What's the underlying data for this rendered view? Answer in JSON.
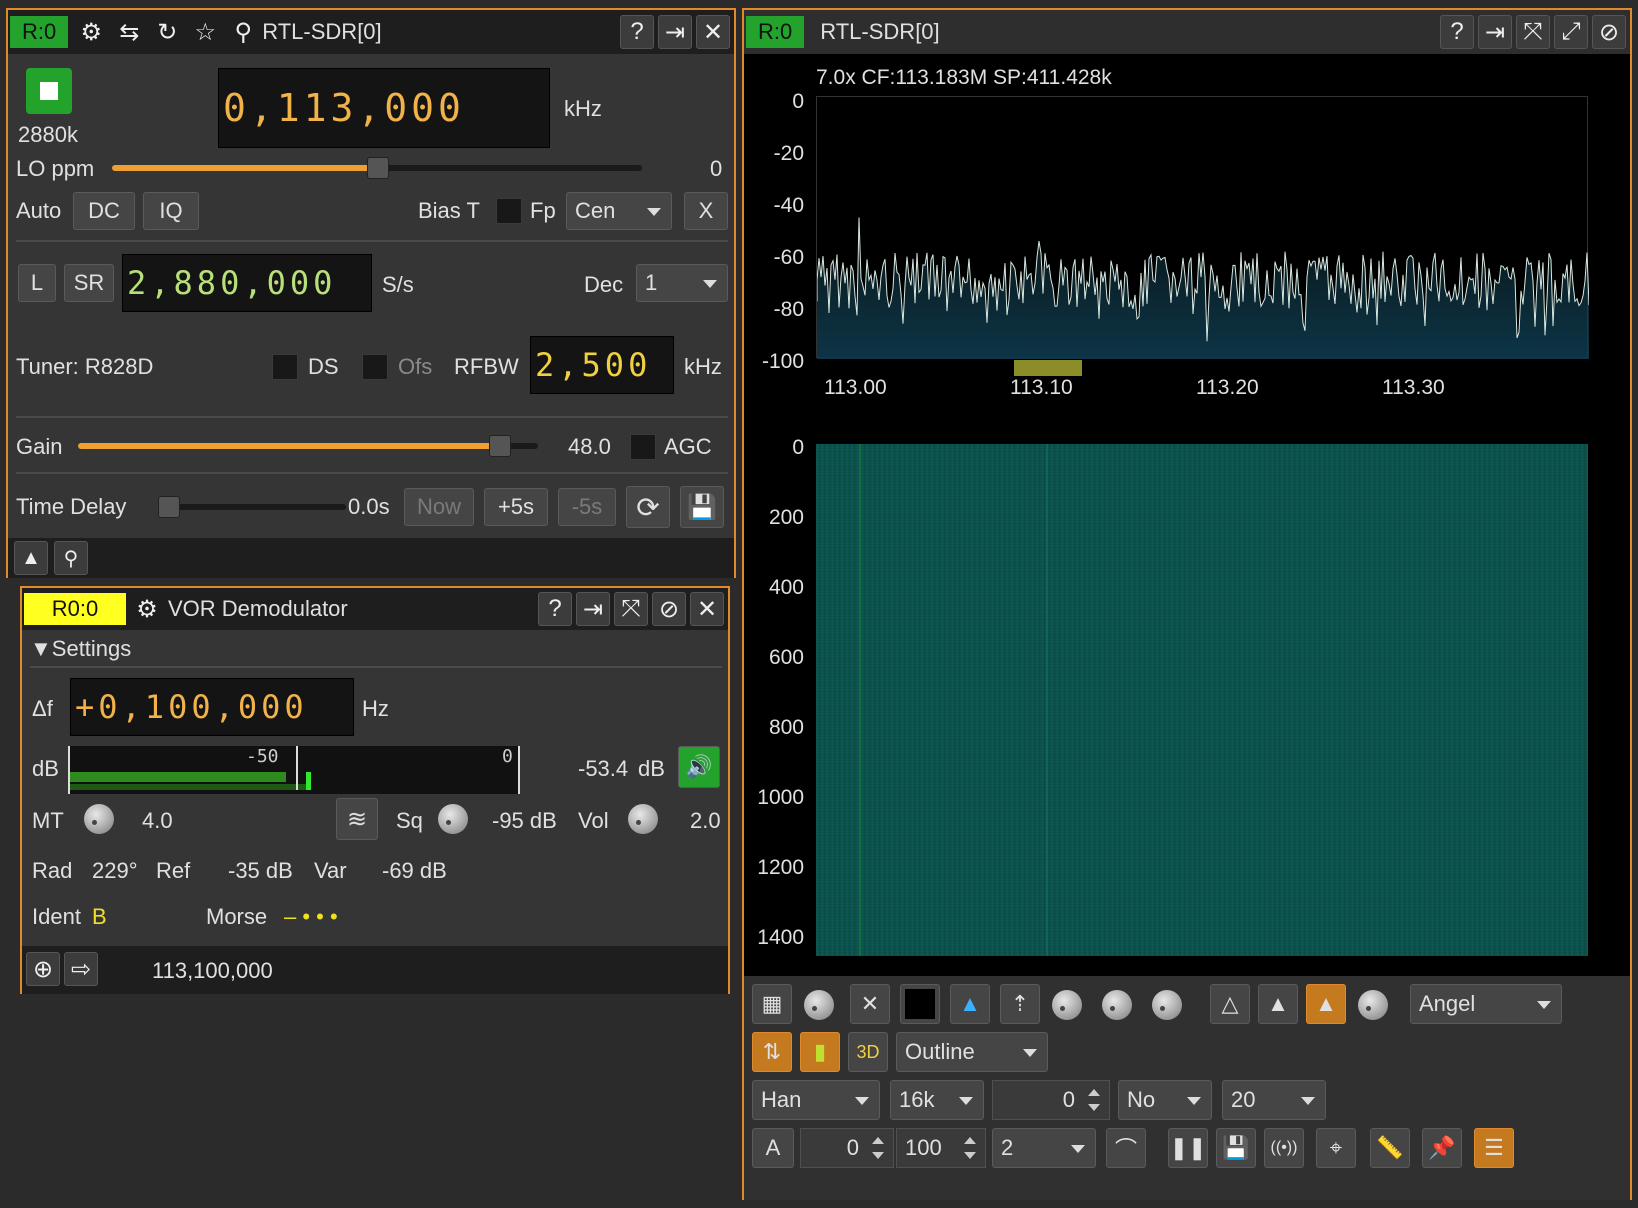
{
  "device": {
    "badge": "R:0",
    "title": "RTL-SDR[0]",
    "sample_rate_label": "2880k",
    "center_freq": "0,113,000",
    "center_freq_unit": "kHz",
    "lo_ppm_label": "LO ppm",
    "lo_ppm_value": "0",
    "auto_label": "Auto",
    "dc_label": "DC",
    "iq_label": "IQ",
    "bias_t_label": "Bias T",
    "fp_label": "Fp",
    "fp_select": "Cen",
    "x_label": "X",
    "l_label": "L",
    "sr_label": "SR",
    "sr_value": "2,880,000",
    "sr_unit": "S/s",
    "dec_label": "Dec",
    "dec_value": "1",
    "tuner_label": "Tuner: R828D",
    "ds_label": "DS",
    "ofs_label": "Ofs",
    "rfbw_label": "RFBW",
    "rfbw_value": "2,500",
    "rfbw_unit": "kHz",
    "gain_label": "Gain",
    "gain_value": "48.0",
    "agc_label": "AGC",
    "time_delay_label": "Time Delay",
    "time_delay_value": "0.0s",
    "now_label": "Now",
    "plus5_label": "+5s",
    "minus5_label": "-5s",
    "lo_ppm_fraction": 0.5,
    "gain_fraction": 0.93
  },
  "vor": {
    "badge": "R0:0",
    "title": "VOR Demodulator",
    "settings_label": "Settings",
    "df_label": "Δf",
    "df_value": "+0,100,000",
    "df_unit": "Hz",
    "db_label": "dB",
    "meter_tick_50": "-50",
    "meter_tick_0": "0",
    "db_value": "-53.4",
    "db_unit": "dB",
    "mt_label": "MT",
    "mt_value": "4.0",
    "sq_label": "Sq",
    "sq_value": "-95 dB",
    "vol_label": "Vol",
    "vol_value": "2.0",
    "rad_label": "Rad",
    "rad_value": "229°",
    "ref_label": "Ref",
    "ref_value": "-35 dB",
    "var_label": "Var",
    "var_value": "-69 dB",
    "ident_label": "Ident",
    "ident_value": "B",
    "morse_label": "Morse",
    "morse_value": "– • • •",
    "footer_freq": "113,100,000"
  },
  "spectrum": {
    "badge": "R:0",
    "title": "RTL-SDR[0]",
    "info": "7.0x CF:113.183M SP:411.428k",
    "y_ticks": [
      "0",
      "-20",
      "-40",
      "-60",
      "-80",
      "-100"
    ],
    "x_ticks": [
      "113.00",
      "113.10",
      "113.20",
      "113.30"
    ],
    "wf_ticks": [
      "0",
      "200",
      "400",
      "600",
      "800",
      "1000",
      "1200",
      "1400"
    ],
    "palette_select": "Angel",
    "fill_select": "Outline",
    "window_select": "Han",
    "fft_select": "16k",
    "overlap_value": "0",
    "avg_select": "No",
    "rate_select": "20",
    "a_label": "A",
    "ref_spin": "0",
    "range_spin": "100",
    "decay_select": "2",
    "threed_label": "3D"
  },
  "colors": {
    "accent": "#e08a2e",
    "badge_green": "#23a32b",
    "badge_yellow": "#ffff20",
    "waterfall": "#0e5a55"
  }
}
